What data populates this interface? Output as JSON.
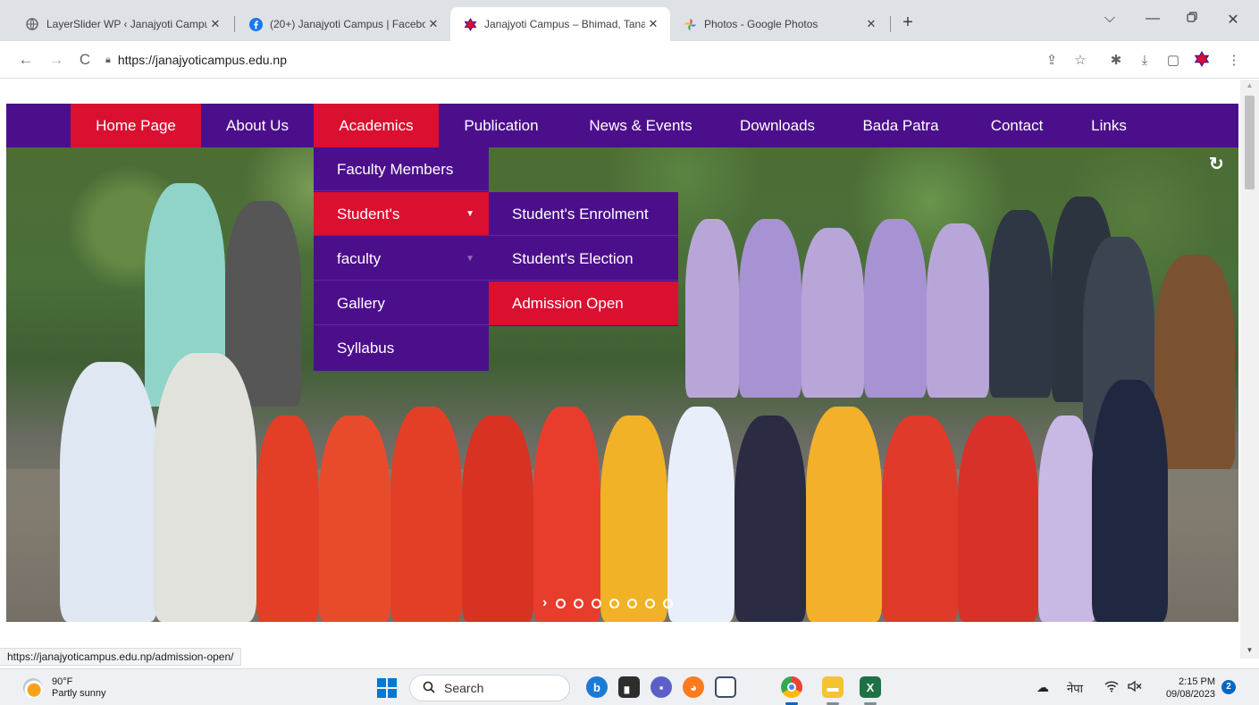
{
  "browser": {
    "tabs": [
      {
        "title": "LayerSlider WP ‹ Janajyoti Campu",
        "icon": "globe-icon"
      },
      {
        "title": "(20+) Janajyoti Campus | Facebo",
        "icon": "facebook-icon"
      },
      {
        "title": "Janajyoti Campus – Bhimad, Tana",
        "icon": "campus-logo-icon"
      },
      {
        "title": "Photos - Google Photos",
        "icon": "google-photos-icon"
      }
    ],
    "new_tab": "+",
    "url": "https://janajyoticampus.edu.np",
    "status_url": "https://janajyoticampus.edu.np/admission-open/"
  },
  "nav": {
    "items": [
      "Home Page",
      "About Us",
      "Academics",
      "Publication",
      "News & Events",
      "Downloads",
      "Bada Patra",
      "Contact",
      "Links"
    ]
  },
  "dropdown": {
    "academics": [
      "Faculty Members",
      "Student's",
      "faculty",
      "Gallery",
      "Syllabus"
    ],
    "students": [
      "Student's Enrolment",
      "Student's Election",
      "Admission Open"
    ]
  },
  "hero": {
    "dot_count": 7
  },
  "taskbar": {
    "weather_temp": "90°F",
    "weather_desc": "Partly sunny",
    "search_label": "Search",
    "language": "नेपा",
    "time": "2:15 PM",
    "date": "09/08/2023",
    "notifications": "2"
  },
  "colors": {
    "nav_purple": "#4c0f8c",
    "highlight_red": "#db0f2f"
  }
}
